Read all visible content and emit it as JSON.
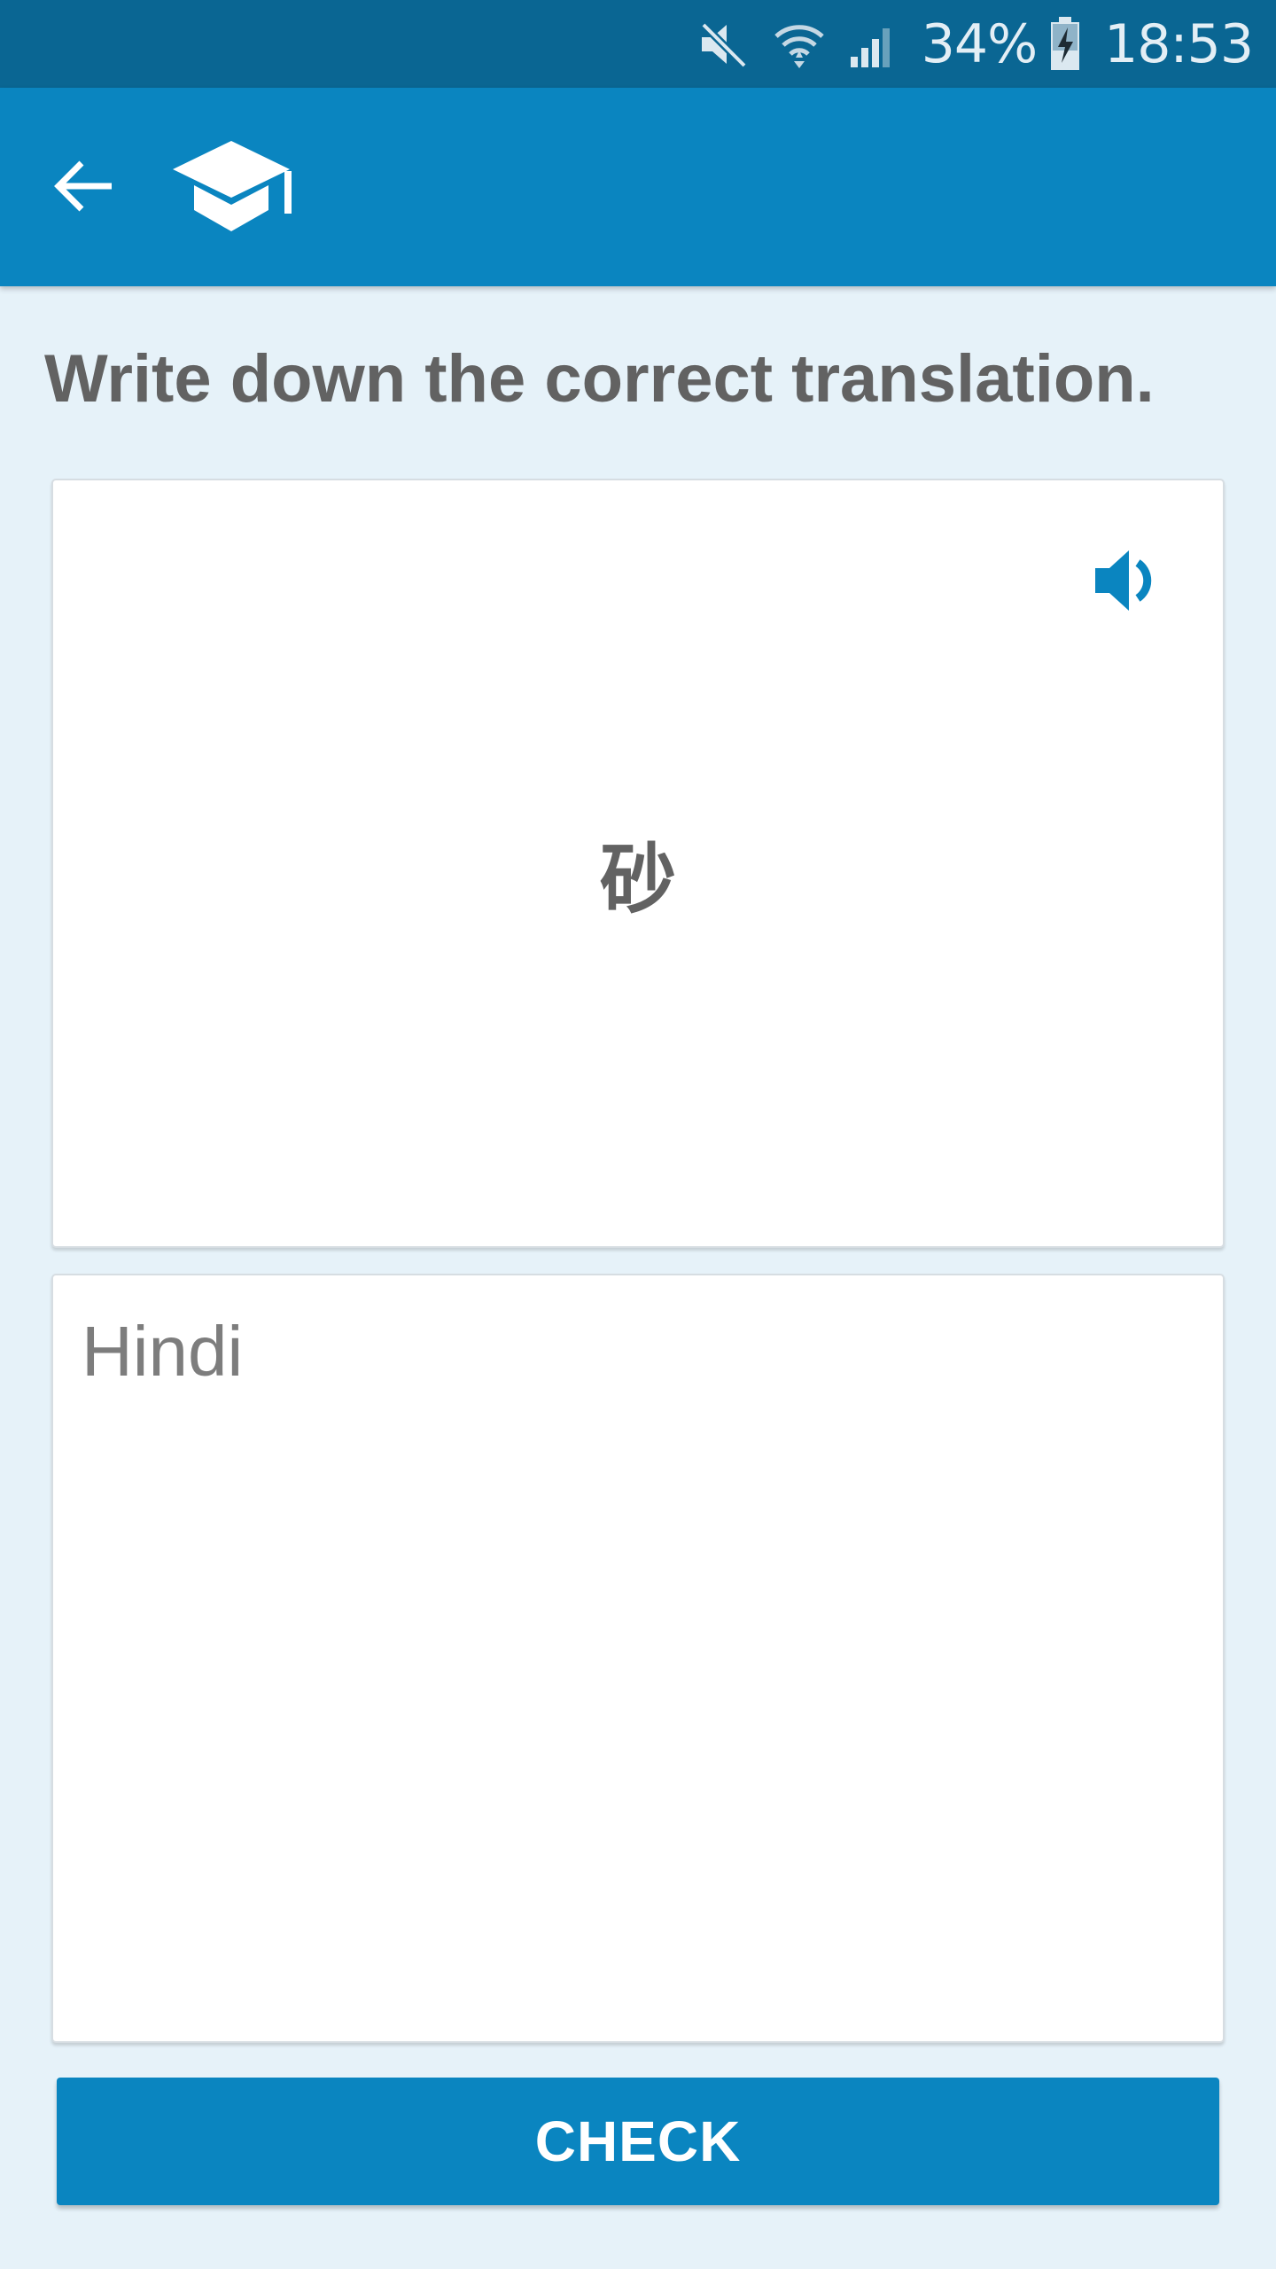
{
  "status_bar": {
    "icons": [
      "mute-icon",
      "wifi-icon",
      "signal-icon",
      "battery-charging-icon"
    ],
    "battery": "34%",
    "time": "18:53"
  },
  "app_bar": {
    "back_icon": "arrow-back-icon",
    "app_icon": "graduation-cap-icon"
  },
  "exercise": {
    "instruction": "Write down the correct translation.",
    "word": "砂",
    "audio_icon": "speaker-icon",
    "answer_value": "",
    "answer_placeholder": "Hindi",
    "check_label": "CHECK"
  },
  "colors": {
    "status_bar": "#0a6693",
    "app_bar": "#0a85c0",
    "background": "#e6f2f9",
    "text": "#626262"
  }
}
